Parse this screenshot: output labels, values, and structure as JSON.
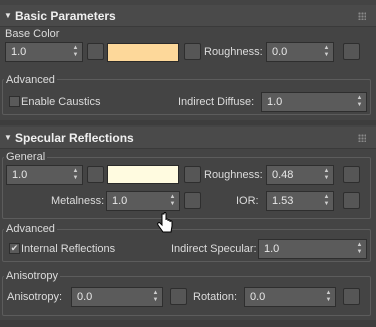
{
  "basic": {
    "header": "Basic Parameters",
    "group_label": "Base Color",
    "base_value": "1.0",
    "swatch_color": "#fdd89a",
    "roughness_label": "Roughness:",
    "roughness_value": "0.0",
    "advanced_label": "Advanced",
    "caustics_label": "Enable Caustics",
    "indirect_diffuse_label": "Indirect Diffuse:",
    "indirect_diffuse_value": "1.0"
  },
  "specular": {
    "header": "Specular Reflections",
    "general_label": "General",
    "value": "1.0",
    "swatch_color": "#fffbe0",
    "roughness_label": "Roughness:",
    "roughness_value": "0.48",
    "metalness_label": "Metalness:",
    "metalness_value": "1.0",
    "ior_label": "IOR:",
    "ior_value": "1.53",
    "advanced_label": "Advanced",
    "internal_reflections_label": "Internal Reflections",
    "internal_reflections_checked": true,
    "indirect_specular_label": "Indirect Specular:",
    "indirect_specular_value": "1.0",
    "anisotropy_group_label": "Anisotropy",
    "anisotropy_label": "Anisotropy:",
    "anisotropy_value": "0.0",
    "rotation_label": "Rotation:",
    "rotation_value": "0.0"
  },
  "glyphs": {
    "collapse": "▼",
    "check": "✔",
    "spin": "▲▼"
  }
}
